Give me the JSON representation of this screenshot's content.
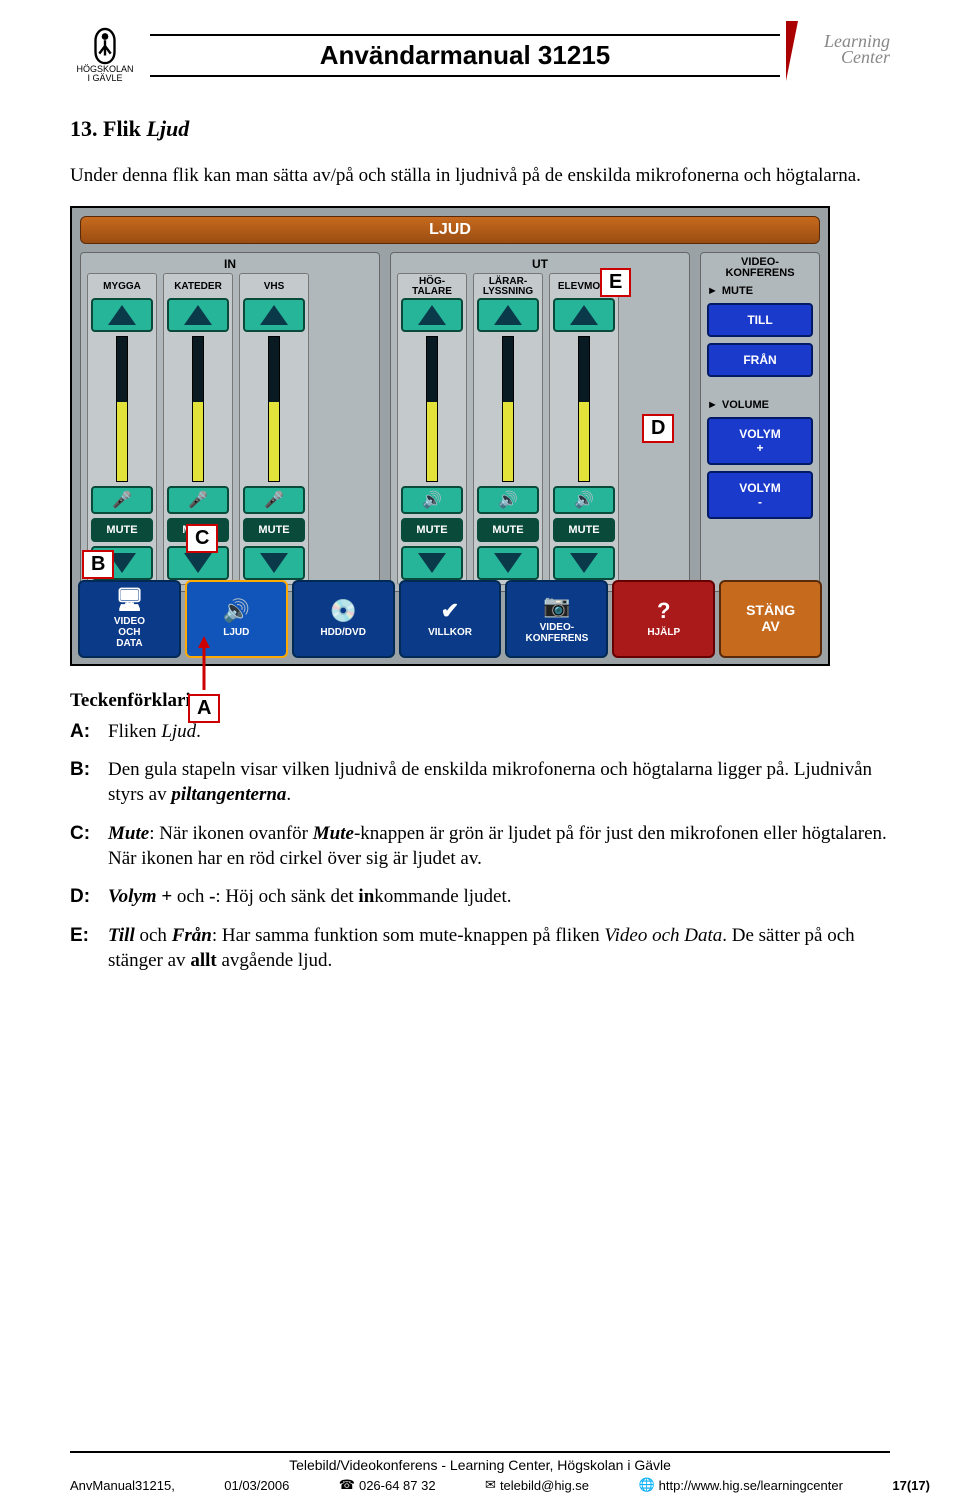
{
  "header": {
    "title": "Användarmanual 31215",
    "logo_hig_line1": "HÖGSKOLAN",
    "logo_hig_line2": "I GÄVLE",
    "logo_lc_line1": "Learning",
    "logo_lc_line2": "Center"
  },
  "section": {
    "number": "13.",
    "title_plain": "Flik",
    "title_italic": "Ljud"
  },
  "intro": "Under denna flik kan man sätta av/på och ställa in ljudnivå på de enskilda mikrofonerna och högtalarna.",
  "callouts": {
    "A": "A",
    "B": "B",
    "C": "C",
    "D": "D",
    "E": "E"
  },
  "panel": {
    "title": "LJUD",
    "group_in": "IN",
    "group_ut": "UT",
    "group_vk_line1": "VIDEO-",
    "group_vk_line2": "KONFERENS",
    "channels_in": [
      "MYGGA",
      "KATEDER",
      "VHS"
    ],
    "channels_ut": [
      "HÖG-\nTALARE",
      "LÄRAR-\nLYSSNING",
      "ELEVMON."
    ],
    "mute": "MUTE",
    "vk_mute_arrow": "MUTE",
    "till": "TILL",
    "fran": "FRÅN",
    "volume_label": "VOLUME",
    "vol_plus": "VOLYM\n+",
    "vol_minus": "VOLYM\n-",
    "tabs": [
      {
        "label": "VIDEO\nOCH\nDATA",
        "icon": "display-icon"
      },
      {
        "label": "LJUD",
        "icon": "speaker-icon"
      },
      {
        "label": "HDD/DVD",
        "icon": "disc-icon"
      },
      {
        "label": "VILLKOR",
        "icon": "check-icon"
      },
      {
        "label": "VIDEO-\nKONFERENS",
        "icon": "camera-icon"
      },
      {
        "label": "HJÄLP",
        "icon": "help-icon"
      },
      {
        "label": "STÄNG\nAV",
        "icon": ""
      }
    ]
  },
  "legend": {
    "title": "Teckenförklaring:",
    "items": {
      "A": "Fliken <i>Ljud</i>.",
      "B": "Den gula stapeln visar vilken ljudnivå de enskilda mikrofonerna och högtalarna ligger på. Ljudnivån styrs av <b><i>piltangenterna</i></b>.",
      "C": "<b><i>Mute</i></b>: När ikonen ovanför <b><i>Mute</i></b>-knappen är grön är ljudet på för just den mikrofonen eller högtalaren. När ikonen har en röd cirkel över sig är ljudet av.",
      "D": "<b><i>Volym +</i></b> och <b>-</b>: Höj och sänk det <b>in</b>kommande ljudet.",
      "E": "<b><i>Till</i></b> och <b><i>Från</i></b>: Har samma funktion som mute-knappen på fliken <i>Video och Data</i>. De sätter på och stänger av <b>allt</b> avgående ljud."
    }
  },
  "footer": {
    "line1": "Telebild/Videokonferens - Learning Center, Högskolan i Gävle",
    "doc": "AnvManual31215,",
    "date": "01/03/2006",
    "phone": "026-64 87 32",
    "email": "telebild@hig.se",
    "url": "http://www.hig.se/learningcenter",
    "page": "17(17)"
  }
}
